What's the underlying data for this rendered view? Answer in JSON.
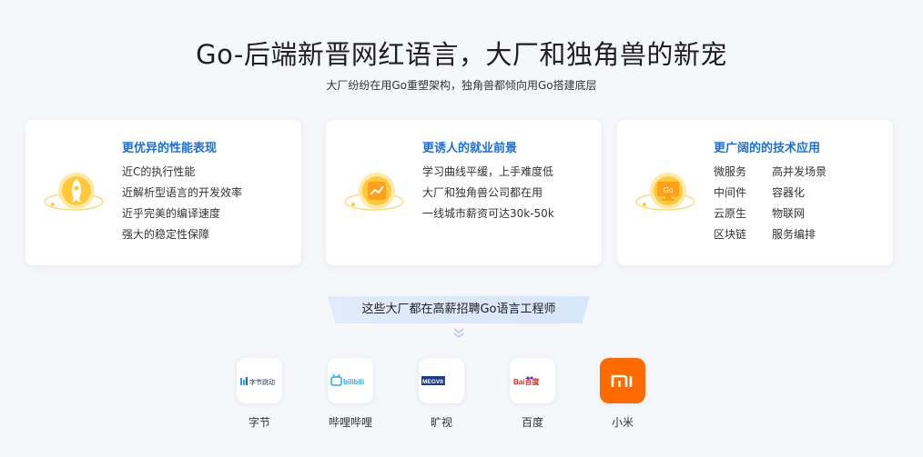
{
  "header": {
    "title": "Go-后端新晋网红语言，大厂和独角兽的新宠",
    "subtitle": "大厂纷纷在用Go重塑架构，独角兽都倾向用Go搭建底层"
  },
  "cards": [
    {
      "title": "更优异的性能表现",
      "icon": "rocket-icon",
      "lines": [
        "近C的执行性能",
        "近解析型语言的开发效率",
        "近乎完美的编译速度",
        "强大的稳定性保障"
      ]
    },
    {
      "title": "更诱人的就业前景",
      "icon": "chart-icon",
      "lines": [
        "学习曲线平缓，上手难度低",
        "大厂和独角兽公司都在用",
        "一线城市薪资可达30k-50k"
      ]
    },
    {
      "title": "更广阔的的技术应用",
      "icon": "go-monitor-icon",
      "icon_text": "Go",
      "grid": [
        "微服务",
        "高并发场景",
        "中间件",
        "容器化",
        "云原生",
        "物联网",
        "区块链",
        "服务编排"
      ]
    }
  ],
  "banner": {
    "text": "这些大厂都在高薪招聘Go语言工程师"
  },
  "companies": [
    {
      "name": "字节",
      "logo_text": "字节跳动",
      "icon": "bytedance-logo"
    },
    {
      "name": "哔哩哔哩",
      "logo_text": "bilibili",
      "icon": "bilibili-logo"
    },
    {
      "name": "旷视",
      "logo_text": "MEGVII 旷视",
      "icon": "megvii-logo"
    },
    {
      "name": "百度",
      "logo_text": "Bai百度",
      "icon": "baidu-logo"
    },
    {
      "name": "小米",
      "logo_text": "mi",
      "icon": "xiaomi-logo"
    }
  ],
  "colors": {
    "accent": "#1a6fdc",
    "icon_yellow": "#ffc93a",
    "xiaomi": "#ff6a00",
    "bilibili": "#23ade5",
    "baidu_red": "#e1251b",
    "baidu_blue": "#2932e1"
  }
}
